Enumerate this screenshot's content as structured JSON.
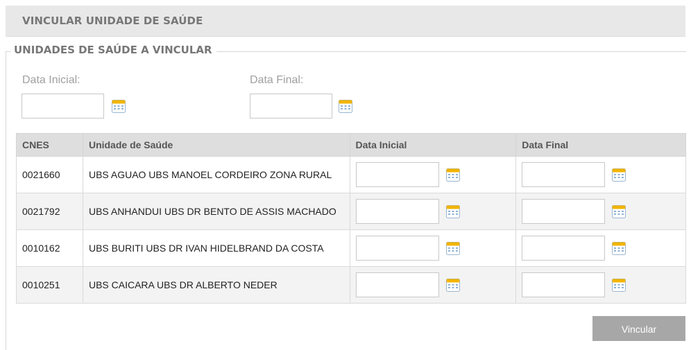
{
  "header": {
    "title": "VINCULAR UNIDADE DE SAÚDE"
  },
  "fieldset": {
    "legend": "UNIDADES DE SAÚDE A VINCULAR"
  },
  "filters": {
    "start_label": "Data Inicial:",
    "start_value": "",
    "end_label": "Data Final:",
    "end_value": ""
  },
  "table": {
    "columns": [
      "CNES",
      "Unidade de Saúde",
      "Data Inicial",
      "Data Final"
    ],
    "rows": [
      {
        "cnes": "0021660",
        "unidade": "UBS AGUAO UBS MANOEL CORDEIRO ZONA RURAL",
        "data_inicial": "",
        "data_final": ""
      },
      {
        "cnes": "0021792",
        "unidade": "UBS ANHANDUI UBS DR BENTO DE ASSIS MACHADO",
        "data_inicial": "",
        "data_final": ""
      },
      {
        "cnes": "0010162",
        "unidade": "UBS BURITI UBS DR IVAN HIDELBRAND DA COSTA",
        "data_inicial": "",
        "data_final": ""
      },
      {
        "cnes": "0010251",
        "unidade": "UBS CAICARA UBS DR ALBERTO NEDER",
        "data_inicial": "",
        "data_final": ""
      }
    ]
  },
  "actions": {
    "vincular_label": "Vincular"
  },
  "icons": {
    "calendar": "calendar-icon"
  },
  "colors": {
    "header_bg": "#e8e8e8",
    "title_text": "#777777",
    "table_header_bg": "#dedede",
    "button_bg": "#a7a7a7",
    "calendar_accent": "#f2b400"
  }
}
